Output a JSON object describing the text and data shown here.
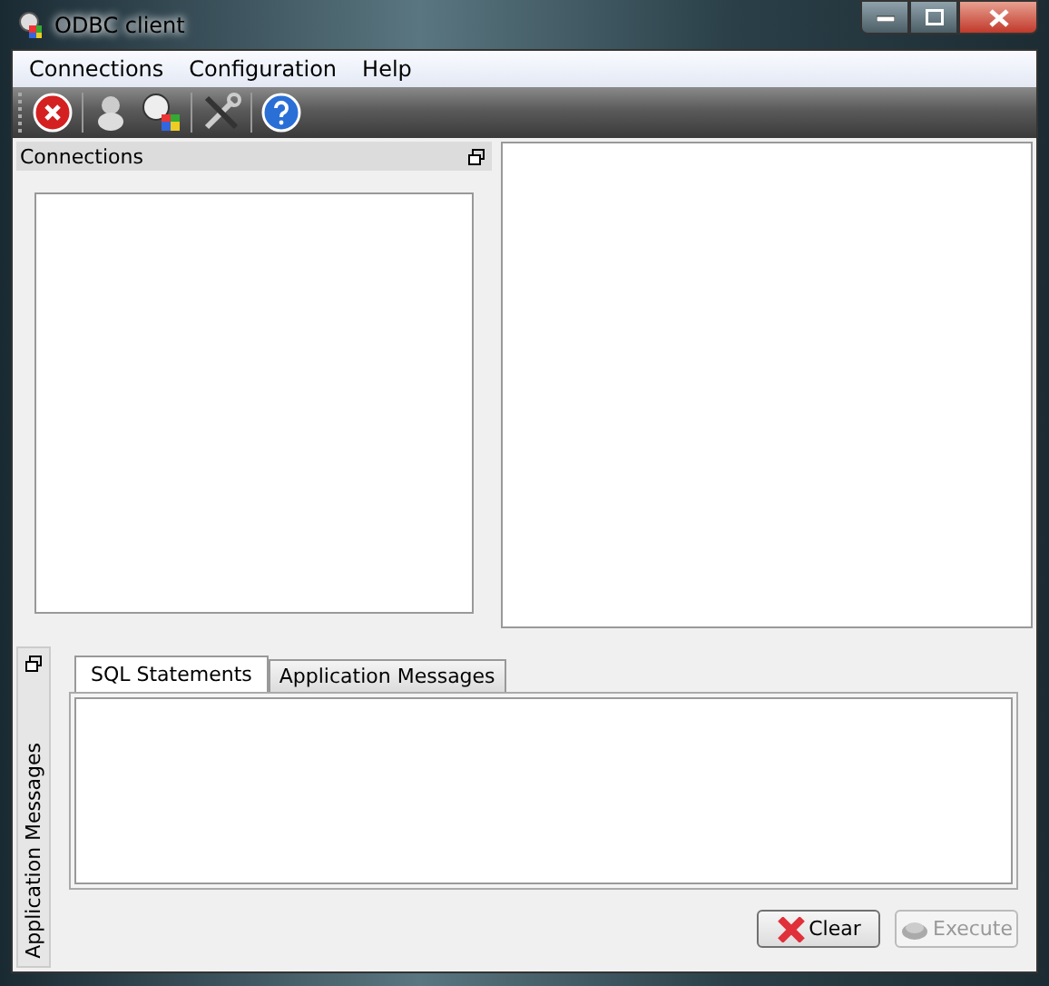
{
  "window": {
    "title": "ODBC client"
  },
  "menu": [
    "Connections",
    "Configuration",
    "Help"
  ],
  "connections_panel": {
    "title": "Connections"
  },
  "messages_dock": {
    "title": "Application Messages"
  },
  "tabs": [
    {
      "label": "SQL Statements",
      "selected": true
    },
    {
      "label": "Application Messages",
      "selected": false
    }
  ],
  "buttons": [
    {
      "label": "Clear",
      "kind": "clear",
      "disabled": false
    },
    {
      "label": "Execute",
      "kind": "execute",
      "disabled": true
    }
  ]
}
